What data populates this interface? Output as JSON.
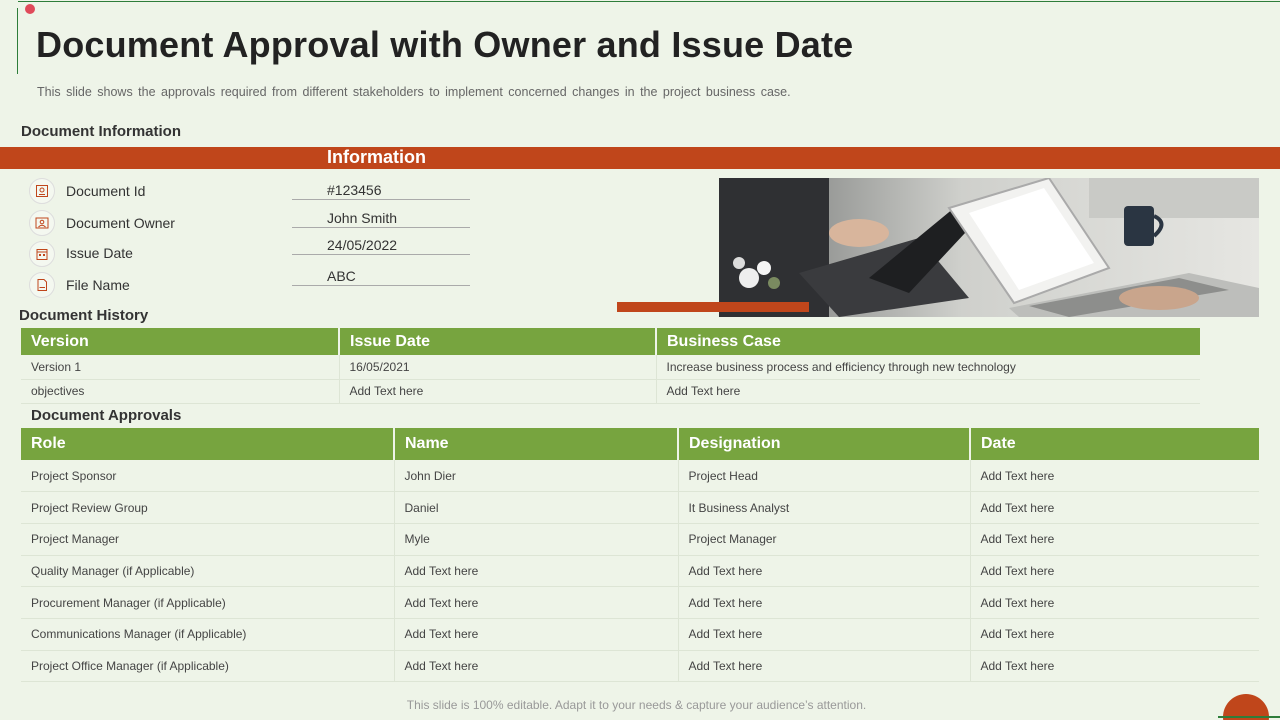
{
  "page": {
    "title": "Document Approval with Owner and Issue Date",
    "subtitle": "This slide shows the approvals  required  from different  stakeholders to implement concerned changes in the project business case.",
    "footer": "This slide is 100% editable. Adapt it to your needs & capture your audience’s attention."
  },
  "colors": {
    "background": "#eef4e8",
    "accent_orange": "#c0461b",
    "header_green": "#77a43f",
    "line_green": "#2e7d3a"
  },
  "document_information": {
    "heading": "Document Information",
    "bar_label": "Information",
    "fields": [
      {
        "icon": "id-card-icon",
        "label": "Document Id",
        "value": "#123456"
      },
      {
        "icon": "owner-profile-icon",
        "label": "Document Owner",
        "value": "John Smith"
      },
      {
        "icon": "calendar-icon",
        "label": "Issue Date",
        "value": "24/05/2022"
      },
      {
        "icon": "file-icon",
        "label": "File Name",
        "value": "ABC"
      }
    ]
  },
  "document_history": {
    "heading": "Document History",
    "columns": [
      "Version",
      "Issue Date",
      "Business Case"
    ],
    "rows": [
      [
        "Version 1",
        "16/05/2021",
        "Increase business process and efficiency through new technology"
      ],
      [
        "objectives",
        "Add Text here",
        "Add Text here"
      ]
    ]
  },
  "document_approvals": {
    "heading": "Document Approvals",
    "columns": [
      "Role",
      "Name",
      "Designation",
      "Date"
    ],
    "rows": [
      [
        "Project Sponsor",
        "John Dier",
        "Project Head",
        "Add Text here"
      ],
      [
        "Project Review Group",
        "Daniel",
        "It Business Analyst",
        "Add Text here"
      ],
      [
        "Project Manager",
        "Myle",
        "Project Manager",
        "Add Text here"
      ],
      [
        "Quality Manager (if Applicable)",
        "Add Text here",
        "Add Text here",
        "Add Text here"
      ],
      [
        "Procurement Manager (if Applicable)",
        "Add Text here",
        "Add Text here",
        "Add Text here"
      ],
      [
        "Communications Manager (if Applicable)",
        "Add Text here",
        "Add Text here",
        "Add Text here"
      ],
      [
        "Project Office Manager (if Applicable)",
        "Add Text here",
        "Add Text here",
        "Add Text here"
      ]
    ]
  }
}
